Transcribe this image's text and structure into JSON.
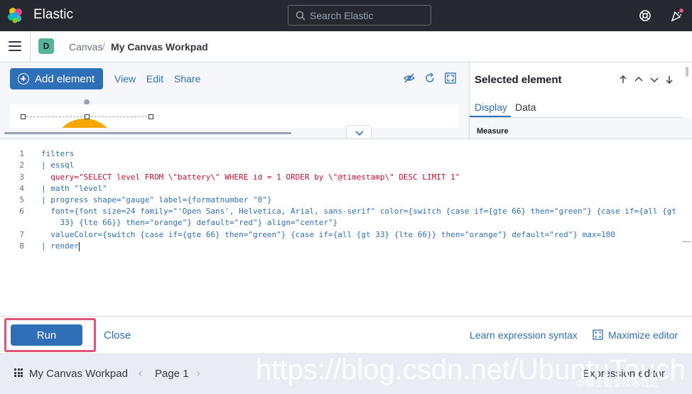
{
  "header": {
    "brand": "Elastic",
    "search_placeholder": "Search Elastic"
  },
  "breadcrumbs": {
    "space_initial": "D",
    "items": [
      "Canvas",
      "My Canvas Workpad"
    ],
    "separator": "/"
  },
  "toolbar": {
    "add_element": "Add element",
    "view": "View",
    "edit": "Edit",
    "share": "Share"
  },
  "right_panel": {
    "title": "Selected element",
    "tabs": [
      "Display",
      "Data"
    ],
    "section": "Measure"
  },
  "editor": {
    "line_numbers": [
      "1",
      "2",
      "3",
      "4",
      "5",
      "6",
      "",
      "7",
      "8"
    ],
    "lines": [
      "filters",
      "| essql",
      "  query=\"SELECT level FROM \\\"battery\\\" WHERE id = 1 ORDER by \\\"@timestamp\\\" DESC LIMIT 1\"",
      "| math \"level\"",
      "| progress shape=\"gauge\" label={formatnumber \"0\"}",
      "  font={font size=24 family=\"'Open Sans', Helvetica, Arial, sans-serif\" color={switch {case if={gte 66} then=\"green\"} {case if={all {gt",
      "    33} {lte 66}} then=\"orange\"} default=\"red\"} align=\"center\"}",
      "  valueColor={switch {case if={gte 66} then=\"green\"} {case if={all {gt 33} {lte 66}} then=\"orange\"} default=\"red\"} max=100",
      "| render"
    ]
  },
  "controls": {
    "run": "Run",
    "close": "Close",
    "learn": "Learn expression syntax",
    "maximize": "Maximize editor"
  },
  "footer": {
    "workpad_name": "My Canvas Workpad",
    "page": "Page 1",
    "expression_editor": "Expression editor"
  },
  "watermark": {
    "url": "https://blog.csdn.net/UbuntuTouch",
    "credit": "@稀土掘金技术社区"
  },
  "colors": {
    "header_bg": "#25282f",
    "primary": "#2f6fb8",
    "highlight": "#e2527a",
    "gauge": "#f5a700"
  }
}
